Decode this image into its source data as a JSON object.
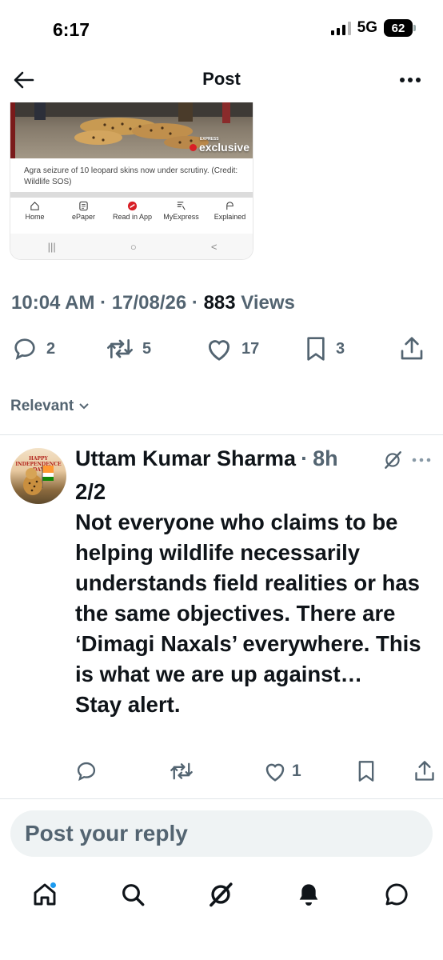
{
  "status_bar": {
    "time": "6:17",
    "network": "5G",
    "battery": "62"
  },
  "header": {
    "title": "Post"
  },
  "embed": {
    "badge_text": "exclusive",
    "badge_small": "EXPRESS",
    "caption": "Agra seizure of 10 leopard skins now under scrutiny. (Credit: Wildlife SOS)",
    "nav": [
      {
        "label": "Home",
        "icon": "home-icon"
      },
      {
        "label": "ePaper",
        "icon": "epaper-icon"
      },
      {
        "label": "Read in App",
        "icon": "app-icon"
      },
      {
        "label": "MyExpress",
        "icon": "myexpress-icon"
      },
      {
        "label": "Explained",
        "icon": "explained-icon"
      }
    ],
    "sysnav": [
      "|||",
      "○",
      "<"
    ]
  },
  "meta": {
    "time": "10:04 AM",
    "sep1": " · ",
    "date": "17/08/26",
    "sep2": " · ",
    "views_count": "883",
    "views_label": " Views"
  },
  "actions": {
    "replies": "2",
    "reposts": "5",
    "likes": "17",
    "bookmarks": "3"
  },
  "sort": {
    "label": "Relevant"
  },
  "reply": {
    "avatar_banner": "HAPPY INDEPENDENCE DAY",
    "author": "Uttam Kumar Sharma",
    "dot": "·",
    "time": "8h",
    "lines": [
      "2/2",
      "Not everyone who claims to be helping wildlife necessarily understands field realities or has the same objectives. There are ‘Dimagi Naxals’ everywhere. This is what we are up against…",
      "Stay alert."
    ],
    "likes": "1"
  },
  "reply_box": {
    "placeholder": "Post your reply"
  },
  "colors": {
    "accent": "#1d9bf0",
    "secondary_text": "#536471",
    "primary_text": "#0f1419",
    "badge_red": "#d81f26"
  }
}
